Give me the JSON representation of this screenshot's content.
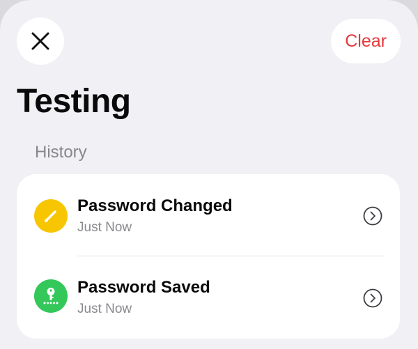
{
  "header": {
    "close_icon": "close-icon",
    "clear_label": "Clear",
    "clear_color": "#e5383b"
  },
  "page": {
    "title": "Testing"
  },
  "history": {
    "section_label": "History",
    "items": [
      {
        "title": "Password Changed",
        "subtitle": "Just Now",
        "icon": "pencil-icon",
        "icon_color": "#f7c600"
      },
      {
        "title": "Password Saved",
        "subtitle": "Just Now",
        "icon": "key-icon",
        "icon_color": "#34c759"
      }
    ]
  },
  "colors": {
    "sheet_background": "#f0f0f5",
    "card_background": "#ffffff",
    "chevron": "#3c3c43"
  }
}
